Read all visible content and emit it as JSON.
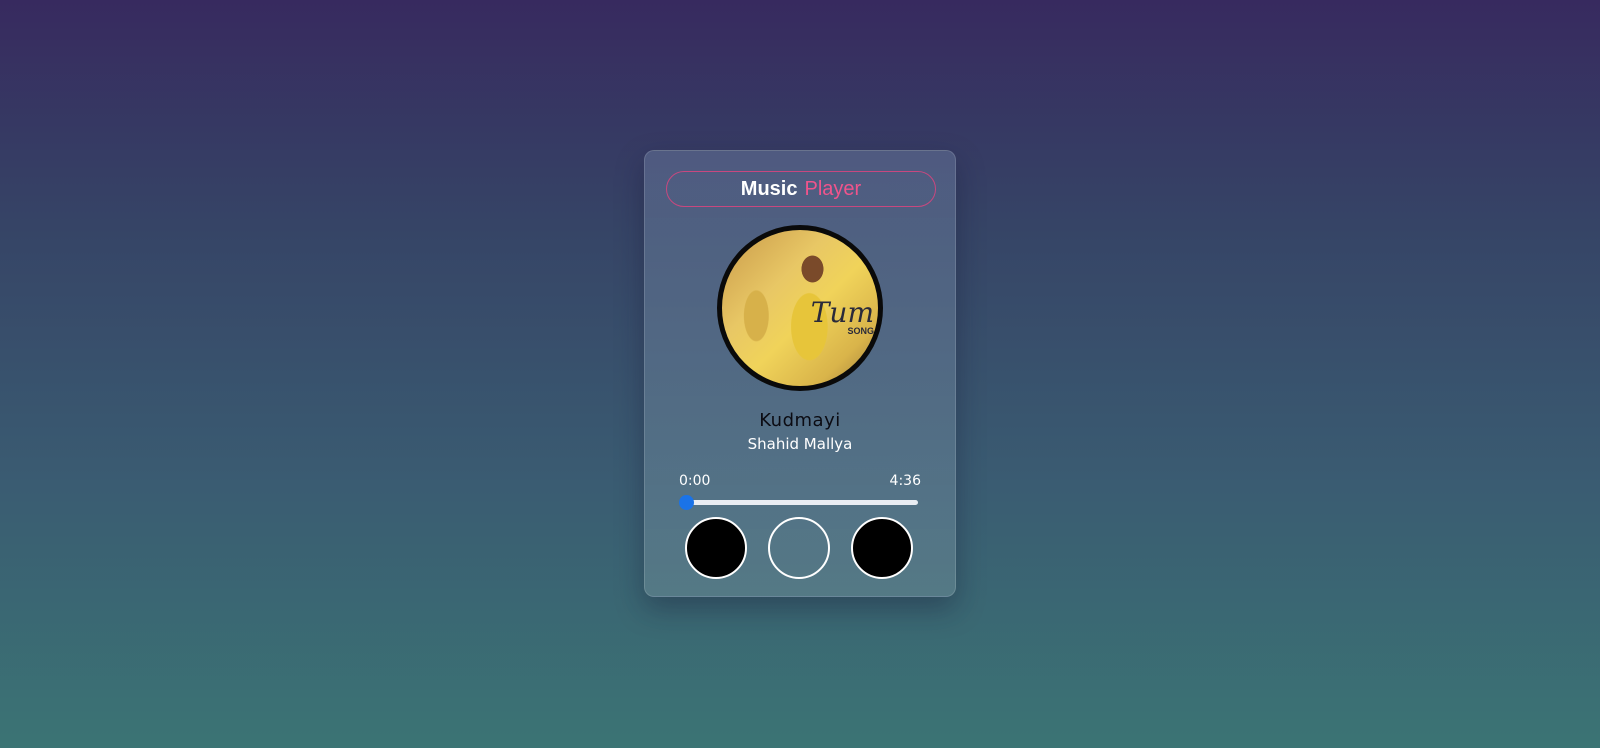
{
  "header": {
    "title_part1": "Music",
    "title_part2": "Player"
  },
  "cover": {
    "art_text": "Tum",
    "art_subtext": "SONG"
  },
  "track": {
    "title": "Kudmayi",
    "artist": "Shahid Mallya"
  },
  "progress": {
    "current_time": "0:00",
    "total_time": "4:36",
    "fraction": 0.0
  },
  "controls": {
    "prev_icon": "previous-icon",
    "play_icon": "play-icon",
    "next_icon": "next-icon"
  },
  "colors": {
    "accent_pink": "#f0548c",
    "progress_blue": "#1a73e8"
  }
}
